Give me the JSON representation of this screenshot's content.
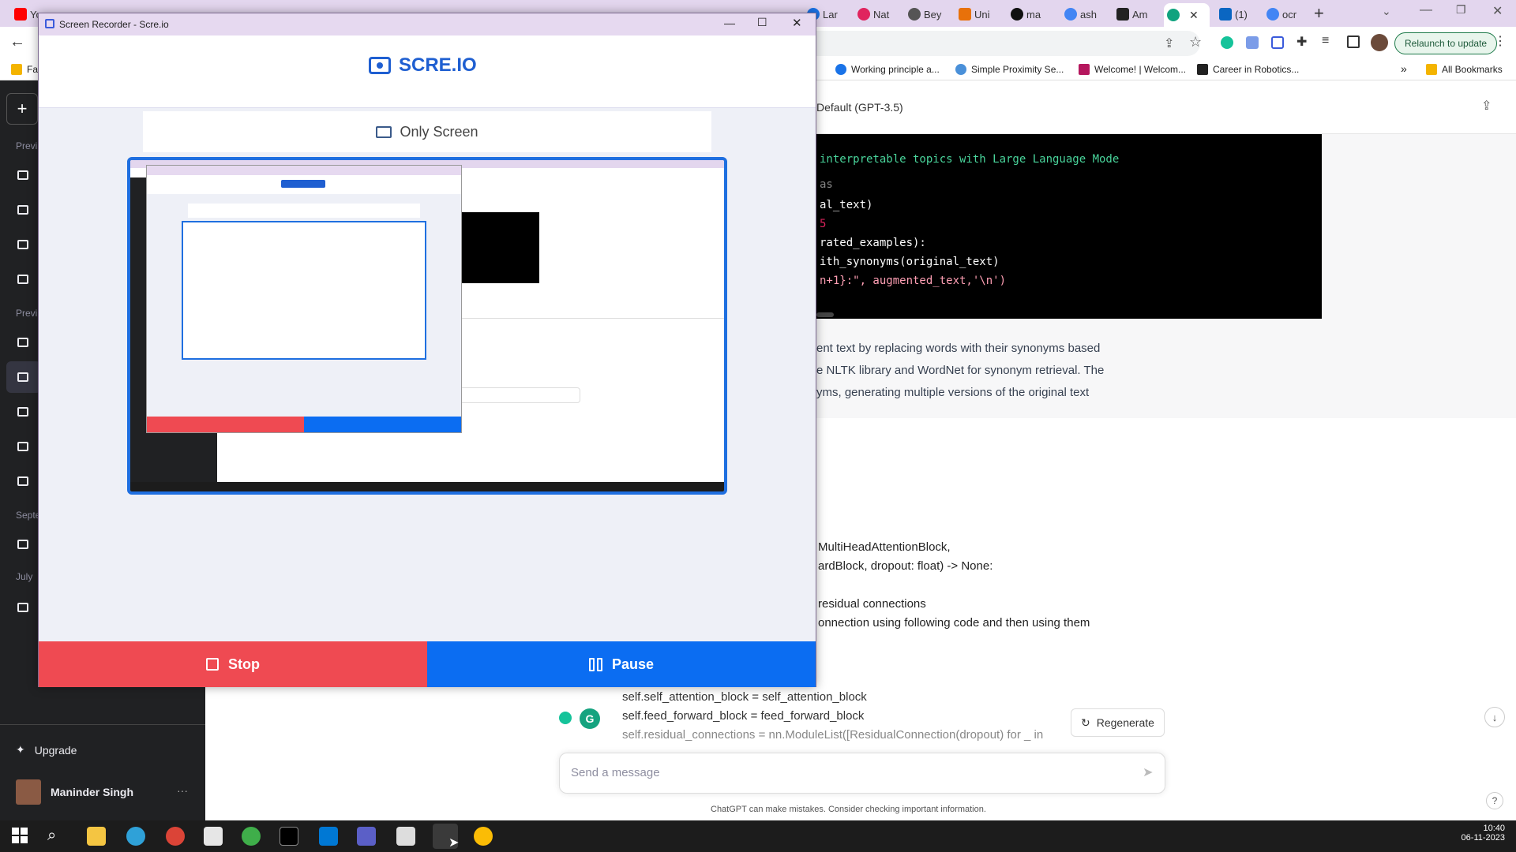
{
  "browser": {
    "tabs": [
      {
        "label": "Yo",
        "color": "#ff0000"
      },
      {
        "label": "Lar",
        "color": "#1a73e8"
      },
      {
        "label": "Nat",
        "color": "#e0245e"
      },
      {
        "label": "Bey",
        "color": "#555555"
      },
      {
        "label": "Uni",
        "color": "#e8710a"
      },
      {
        "label": "ma",
        "color": "#111111"
      },
      {
        "label": "ash",
        "color": "#4285f4"
      },
      {
        "label": "Am",
        "color": "#222222"
      },
      {
        "label": "",
        "color": "#10a37f"
      },
      {
        "label": "(1)",
        "color": "#0a66c2"
      },
      {
        "label": "ocr",
        "color": "#4285f4"
      }
    ],
    "relaunch_label": "Relaunch to update",
    "bookmarks": [
      {
        "label": "Fa"
      },
      {
        "label": "Working principle a..."
      },
      {
        "label": "Simple Proximity Se..."
      },
      {
        "label": "Welcome! | Welcom..."
      },
      {
        "label": "Career in Robotics..."
      }
    ],
    "all_bookmarks_label": "All Bookmarks"
  },
  "chat": {
    "model_label": "Default (GPT-3.5)",
    "sidebar": {
      "new_chat": "+",
      "section_labels": [
        "Previ",
        "Previ",
        "Septe",
        "July"
      ],
      "upgrade_label": "Upgrade",
      "user_name": "Maninder Singh",
      "more": "···"
    },
    "code_lines": [
      "interpretable topics with Large Language Mode",
      "as",
      "al_text)",
      "rated_examples):",
      "ith_synonyms(original_text)",
      "n+1}:\", augmented_text,'\\n')"
    ],
    "answer_lines": [
      "ent text by replacing words with their synonyms based",
      "e NLTK library and WordNet for synonym retrieval. The",
      "yms, generating multiple versions of the original text"
    ],
    "user_lines": [
      "MultiHeadAttentionBlock,",
      "ardBlock, dropout: float) -> None:",
      "residual connections",
      "onnection using following code and then using them"
    ],
    "input_code_lines": [
      "self.self_attention_block = self_attention_block",
      "self.feed_forward_block = feed_forward_block",
      "self.residual_connections = nn.ModuleList([ResidualConnection(dropout) for _ in"
    ],
    "regenerate_label": "Regenerate",
    "input_placeholder": "Send a message",
    "disclaimer": "ChatGPT can make mistakes. Consider checking important information.",
    "help": "?"
  },
  "recorder": {
    "window_title": "Screen Recorder - Scre.io",
    "brand": "SCRE.IO",
    "mode_label": "Only Screen",
    "stop_label": "Stop",
    "pause_label": "Pause"
  },
  "taskbar": {
    "time": "10:40",
    "date": "06-11-2023"
  }
}
